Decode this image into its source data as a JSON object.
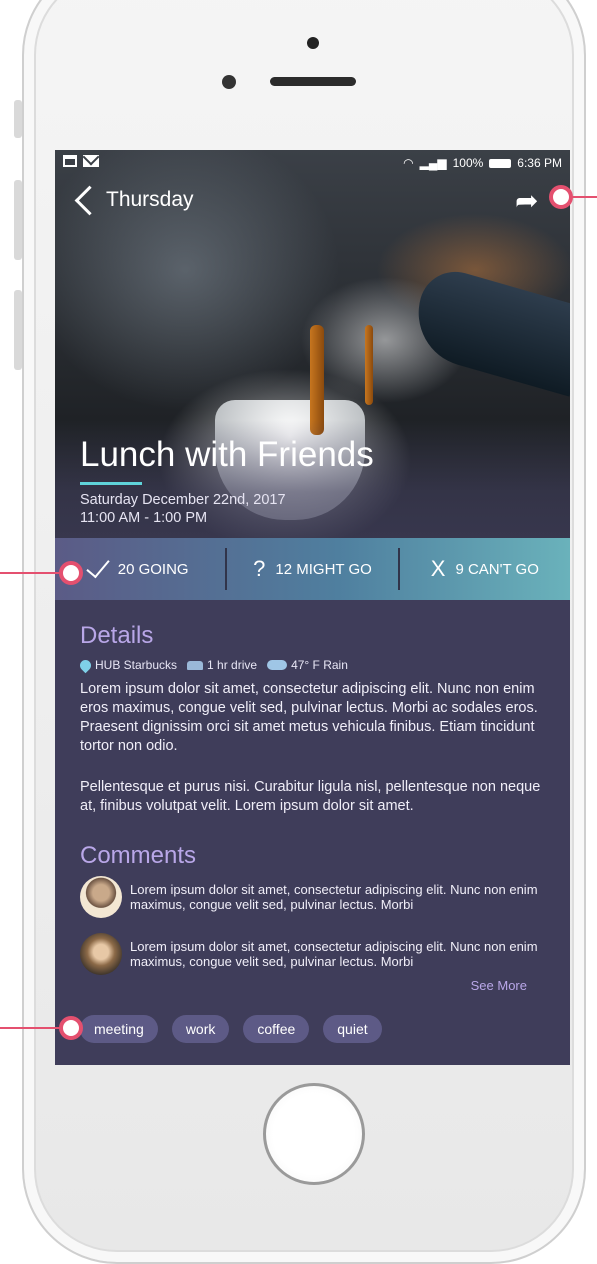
{
  "status_bar": {
    "battery": "100%",
    "time": "6:36 PM"
  },
  "nav": {
    "back_label": "Thursday"
  },
  "event": {
    "title": "Lunch with Friends",
    "date": "Saturday December 22nd, 2017",
    "time": "11:00 AM - 1:00 PM"
  },
  "rsvp": {
    "going": "20 GOING",
    "maybe_symbol": "?",
    "maybe": "12 MIGHT GO",
    "cant_symbol": "X",
    "cant": "9 CAN'T GO"
  },
  "details": {
    "heading": "Details",
    "location": "HUB Starbucks",
    "travel": "1 hr drive",
    "weather": "47° F Rain",
    "para1": "Lorem ipsum dolor sit amet, consectetur adipiscing elit. Nunc non enim eros maximus, congue velit sed, pulvinar lectus. Morbi ac sodales eros. Praesent dignissim orci sit amet metus vehicula finibus. Etiam tincidunt tortor non odio.",
    "para2": "Pellentesque et purus nisi. Curabitur ligula nisl, pellentesque non neque at, finibus volutpat velit. Lorem ipsum dolor sit amet."
  },
  "comments": {
    "heading": "Comments",
    "items": [
      {
        "text": "Lorem ipsum dolor sit amet, consectetur adipiscing elit. Nunc non enim maximus, congue velit sed, pulvinar lectus. Morbi"
      },
      {
        "text": "Lorem ipsum dolor sit amet, consectetur adipiscing elit. Nunc non enim maximus, congue velit sed, pulvinar lectus. Morbi"
      }
    ],
    "see_more": "See More"
  },
  "tags": [
    "meeting",
    "work",
    "coffee",
    "quiet"
  ],
  "colors": {
    "screen_bg": "#3f3d5a",
    "accent_purple": "#b9a7e8",
    "accent_teal": "#5fd3d9",
    "callout": "#e4506f",
    "tag_bg": "#5d5a86"
  }
}
